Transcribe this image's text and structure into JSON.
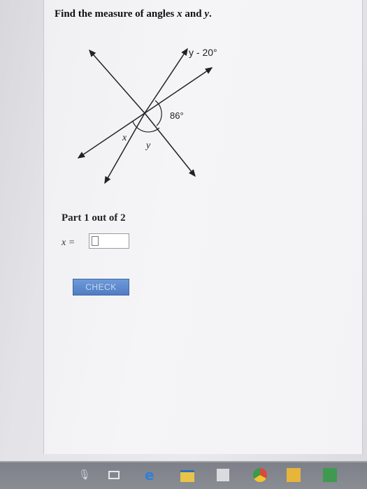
{
  "question": {
    "prefix": "Find the measure of angles ",
    "var_x": "x",
    "middle": " and ",
    "var_y": "y",
    "suffix": "."
  },
  "diagram": {
    "label_y_minus_20": "y - 20°",
    "label_86": "86°",
    "label_x": "x",
    "label_y": "y"
  },
  "part": {
    "text": "Part 1 out of 2"
  },
  "answer": {
    "label": "x =",
    "value": ""
  },
  "check_button": {
    "label": "CHECK"
  },
  "colors": {
    "accent": "#4f7dc4",
    "taskbar": "#8a8d94"
  },
  "taskbar_icons": [
    "microphone-icon",
    "task-view-icon",
    "edge-icon",
    "file-explorer-icon",
    "store-icon",
    "chrome-icon",
    "folder-icon",
    "app-icon"
  ]
}
